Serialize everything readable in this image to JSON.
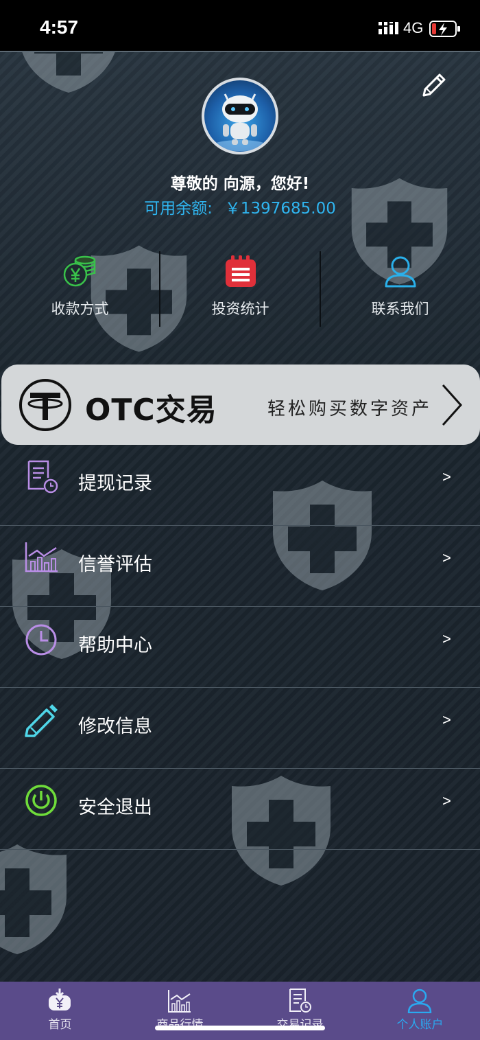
{
  "status_bar": {
    "time": "4:57",
    "network": "4G"
  },
  "profile": {
    "greeting": "尊敬的 向源，您好!",
    "balance_label": "可用余额:",
    "balance_value": "￥1397685.00"
  },
  "quick_actions": [
    {
      "label": "收款方式",
      "icon": "coins-yen-icon"
    },
    {
      "label": "投资统计",
      "icon": "calendar-notes-icon"
    },
    {
      "label": "联系我们",
      "icon": "user-contact-icon"
    }
  ],
  "otc": {
    "title": "OTC交易",
    "subtitle": "轻松购买数字资产",
    "icon": "tether-logo"
  },
  "menu": [
    {
      "label": "提现记录",
      "icon": "document-clock-icon",
      "arrow": ">"
    },
    {
      "label": "信誉评估",
      "icon": "chart-icon",
      "arrow": ">"
    },
    {
      "label": "帮助中心",
      "icon": "clock-icon",
      "arrow": ">"
    },
    {
      "label": "修改信息",
      "icon": "pencil-icon",
      "arrow": ">"
    },
    {
      "label": "安全退出",
      "icon": "power-icon",
      "arrow": ">"
    }
  ],
  "tabs": [
    {
      "label": "首页",
      "icon": "home-yen-icon"
    },
    {
      "label": "商品行情",
      "icon": "market-chart-icon"
    },
    {
      "label": "交易记录",
      "icon": "record-icon"
    },
    {
      "label": "个人账户",
      "icon": "account-icon",
      "active": true
    }
  ],
  "colors": {
    "accent": "#2fb5f0",
    "tab_bar": "#5a4b8a",
    "menu_icon_purple": "#b98ee6",
    "menu_icon_cyan": "#4fd6e8",
    "menu_icon_green": "#6fdc3a"
  }
}
